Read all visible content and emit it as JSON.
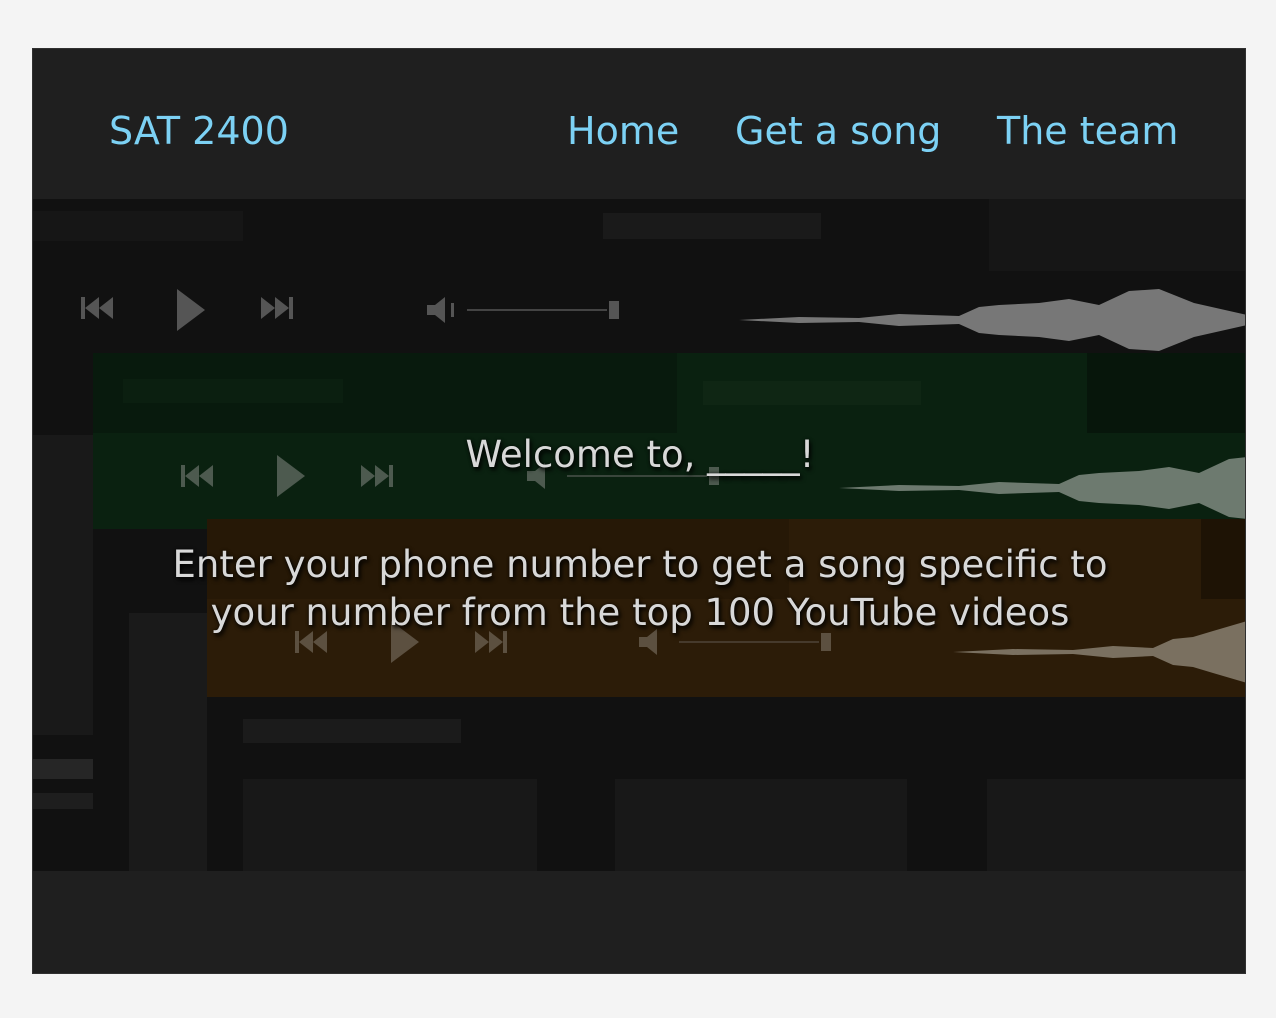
{
  "navbar": {
    "brand": "SAT 2400",
    "links": [
      {
        "label": "Home"
      },
      {
        "label": "Get a song"
      },
      {
        "label": "The team"
      }
    ]
  },
  "hero": {
    "welcome": "Welcome to, _____!",
    "subtitle_line1": "Enter your phone number to get a song specific to",
    "subtitle_line2": "your number from the top 100 YouTube videos",
    "background_players": [
      {
        "controls": [
          "skip-back-icon",
          "play-icon",
          "skip-forward-icon",
          "volume-icon"
        ],
        "tint": "none"
      },
      {
        "controls": [
          "skip-back-icon",
          "play-icon",
          "skip-forward-icon",
          "volume-icon"
        ],
        "tint": "#0b2a12"
      },
      {
        "controls": [
          "skip-back-icon",
          "play-icon",
          "skip-forward-icon",
          "volume-icon"
        ],
        "tint": "#2e1d08"
      }
    ]
  },
  "colors": {
    "accent_link": "#7cd1f4",
    "frame_bg": "#1f1f1f",
    "hero_text": "#d8d8d8"
  }
}
